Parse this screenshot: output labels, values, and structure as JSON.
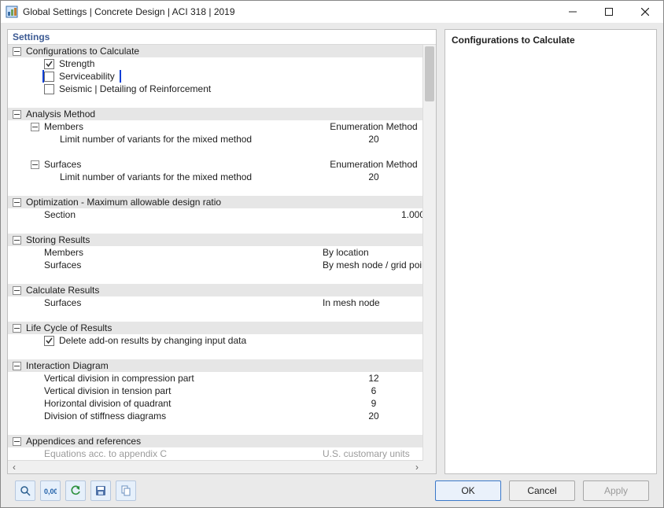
{
  "window": {
    "title": "Global Settings | Concrete Design | ACI 318 | 2019"
  },
  "left": {
    "header": "Settings",
    "sections": {
      "configs": {
        "title": "Configurations to Calculate",
        "strength": "Strength",
        "serviceability": "Serviceability",
        "seismic": "Seismic | Detailing of Reinforcement"
      },
      "analysis": {
        "title": "Analysis Method",
        "members": "Members",
        "members_val": "Enumeration Method",
        "members_limit": "Limit number of variants for the mixed method",
        "members_limit_val": "20",
        "surfaces": "Surfaces",
        "surfaces_val": "Enumeration Method",
        "surfaces_limit": "Limit number of variants for the mixed method",
        "surfaces_limit_val": "20"
      },
      "optimization": {
        "title": "Optimization - Maximum allowable design ratio",
        "section": "Section",
        "section_val": "1.000",
        "section_unit": "--"
      },
      "storing": {
        "title": "Storing Results",
        "members": "Members",
        "members_val": "By location",
        "surfaces": "Surfaces",
        "surfaces_val": "By mesh node / grid point"
      },
      "calculate": {
        "title": "Calculate Results",
        "surfaces": "Surfaces",
        "surfaces_val": "In mesh node"
      },
      "lifecycle": {
        "title": "Life Cycle of Results",
        "delete": "Delete add-on results by changing input data"
      },
      "interaction": {
        "title": "Interaction Diagram",
        "vcomp": "Vertical division in compression part",
        "vcomp_val": "12",
        "vten": "Vertical division in tension part",
        "vten_val": "6",
        "hquad": "Horizontal division of quadrant",
        "hquad_val": "9",
        "stiff": "Division of stiffness diagrams",
        "stiff_val": "20"
      },
      "appendices": {
        "title": "Appendices and references",
        "eq": "Equations acc. to appendix C",
        "eq_val": "U.S. customary units"
      }
    }
  },
  "right": {
    "header": "Configurations to Calculate"
  },
  "buttons": {
    "ok": "OK",
    "cancel": "Cancel",
    "apply": "Apply"
  }
}
